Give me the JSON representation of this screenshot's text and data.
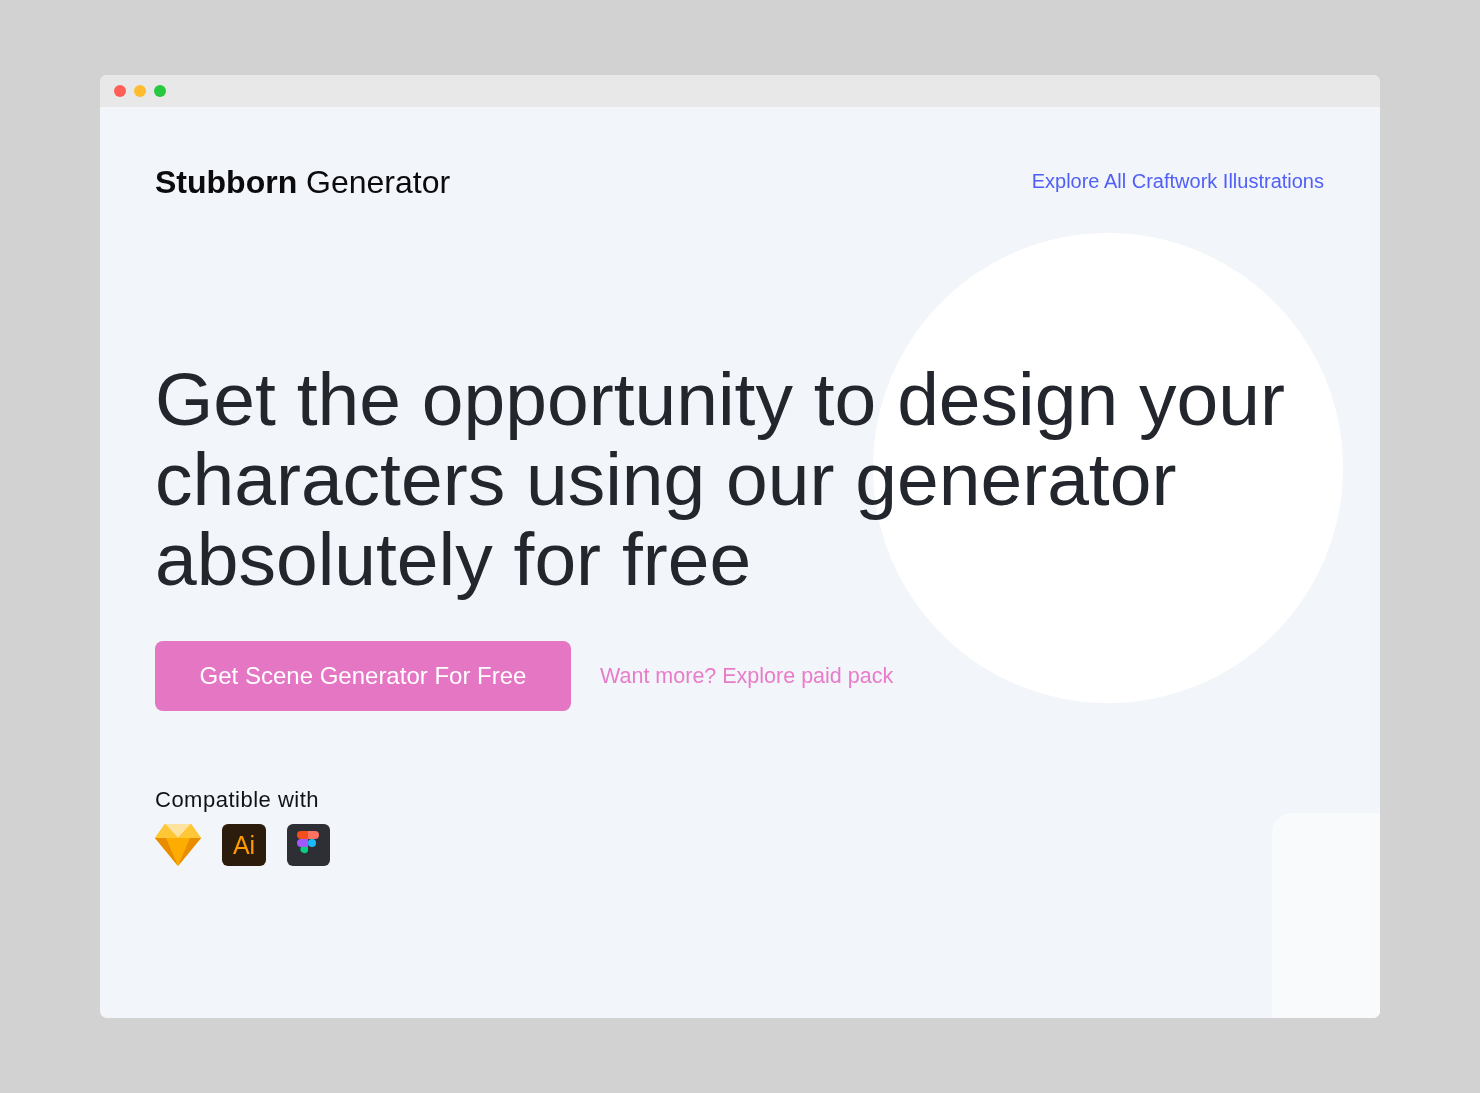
{
  "window": {
    "controls": [
      {
        "color": "#ff5f57"
      },
      {
        "color": "#febc2e"
      },
      {
        "color": "#28c840"
      }
    ]
  },
  "header": {
    "logo": "**Stubborn** Generator",
    "link": "Explore All Craftwork Illustrations"
  },
  "hero": {
    "heading": "Get the opportunity to design your characters using our generator absolutely for free",
    "primary_button": "Get Scene Generator For Free",
    "secondary_link": "Want more? Explore paid pack"
  },
  "compatible": {
    "label": "Compatible with",
    "apps": [
      {
        "kind": "sketch"
      },
      {
        "kind": "illustrator",
        "label": "Ai"
      },
      {
        "kind": "figma"
      }
    ]
  }
}
